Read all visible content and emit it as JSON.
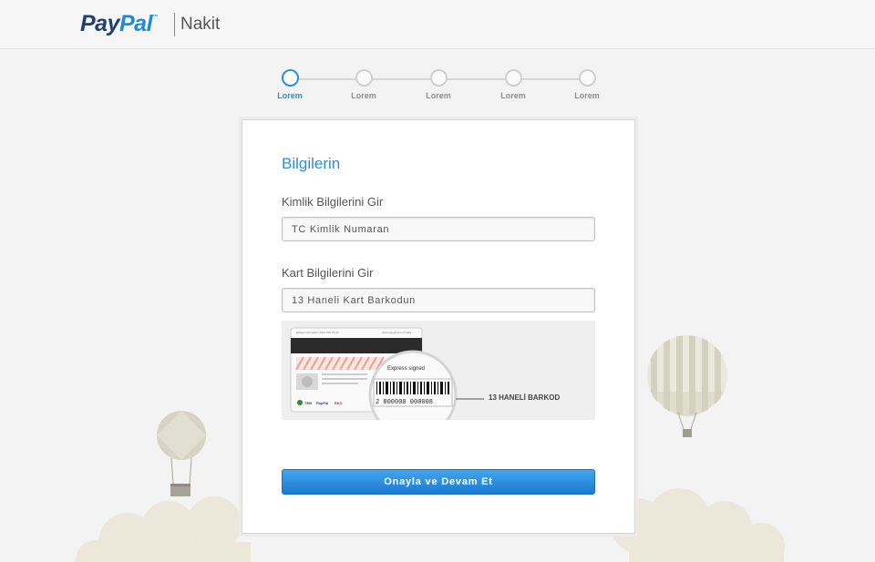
{
  "header": {
    "logo_pay": "Pay",
    "logo_pal": "Pal",
    "logo_tm": "™",
    "product": "Nakit"
  },
  "stepper": {
    "steps": [
      {
        "label": "Lorem",
        "active": true
      },
      {
        "label": "Lorem",
        "active": false
      },
      {
        "label": "Lorem",
        "active": false
      },
      {
        "label": "Lorem",
        "active": false
      },
      {
        "label": "Lorem",
        "active": false
      }
    ]
  },
  "form": {
    "title": "Bilgilerin",
    "identity_label": "Kimlik Bilgilerini Gir",
    "identity_placeholder": "TC Kimlik Numaran",
    "card_label": "Kart Bilgilerini Gir",
    "card_placeholder": "13 Haneli Kart Barkodun",
    "barcode_caption": "13 HANELİ BARKOD",
    "barcode_number": "2 800000 000008",
    "card_header_left": "Müşteri Hizmetleri: 0212 000 00 00",
    "card_header_right": "www.paypal.com.tr/nakit",
    "signature_text": "Express signed",
    "submit_label": "Onayla ve Devam Et"
  },
  "colors": {
    "accent": "#2b8fd6",
    "paypal_dark": "#1d3f75",
    "paypal_light": "#1f8ad5",
    "button_top": "#43a6ee",
    "button_bottom": "#1a7ad0"
  }
}
